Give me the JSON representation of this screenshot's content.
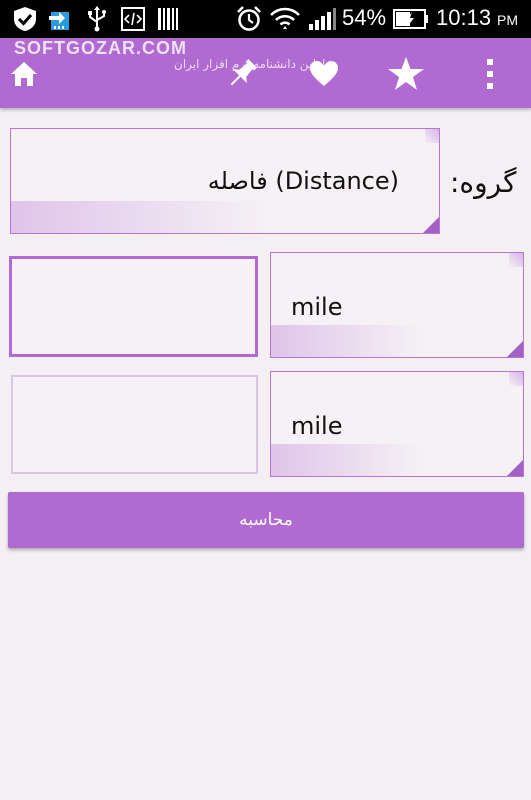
{
  "status_bar": {
    "battery_percent": "54%",
    "time": "10:13",
    "ampm": "PM",
    "icons": [
      "check-shield-icon",
      "sim-download-icon",
      "usb-icon",
      "code-icon",
      "barcode-icon",
      "alarm-icon",
      "wifi-icon",
      "signal-icon",
      "battery-charging-icon"
    ]
  },
  "action_bar": {
    "watermark_line1": "SOFTGOZAR.COM",
    "watermark_line2": "اولین دانشنامه نرم افزار ایران",
    "icons": [
      "home-icon",
      "pin-icon",
      "heart-icon",
      "star-icon",
      "overflow-menu-icon"
    ],
    "color": "#b06ad2"
  },
  "form": {
    "group_label": "گروه:",
    "group_value": "فاصله (Distance)",
    "from_unit": "mile",
    "to_unit": "mile",
    "from_value": "",
    "to_value": ""
  },
  "calculate_button": {
    "label": "محاسبه"
  }
}
